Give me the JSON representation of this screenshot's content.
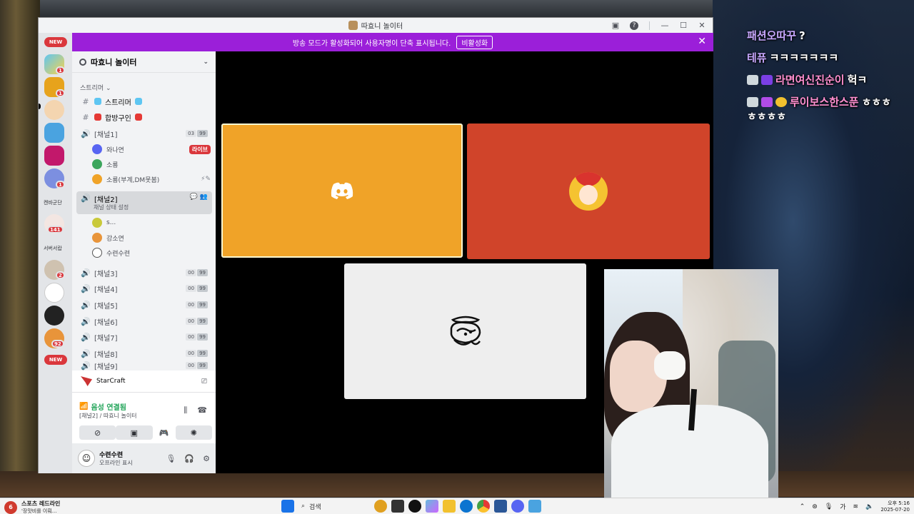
{
  "window": {
    "title": "따효니 놀이터"
  },
  "notice": {
    "text": "방송 모드가 활성화되어 사용자명이 단축 표시됩니다.",
    "button": "비활성화"
  },
  "servers": {
    "new_top": "NEW",
    "new_bottom": "NEW",
    "badges": [
      "1",
      "1",
      "1",
      "141",
      "2",
      "92"
    ],
    "labels": [
      "켄바군단",
      "서버서랍"
    ]
  },
  "guild": {
    "name": "따효니 놀이터"
  },
  "category": "스트리머",
  "text_channels": [
    {
      "label": "스트리머"
    },
    {
      "label": "합방구인"
    }
  ],
  "voice_channels": [
    {
      "label": "[채널1]",
      "c1": "03",
      "c2": "99"
    },
    {
      "label": "[채널2]",
      "sub": "채널 상태 설정"
    },
    {
      "label": "[채널3]",
      "c1": "00",
      "c2": "99"
    },
    {
      "label": "[채널4]",
      "c1": "00",
      "c2": "99"
    },
    {
      "label": "[채널5]",
      "c1": "00",
      "c2": "99"
    },
    {
      "label": "[채널6]",
      "c1": "00",
      "c2": "99"
    },
    {
      "label": "[채널7]",
      "c1": "00",
      "c2": "99"
    },
    {
      "label": "[채널8]",
      "c1": "00",
      "c2": "99"
    },
    {
      "label": "[채널9]",
      "c1": "00",
      "c2": "99"
    }
  ],
  "channel1_users": [
    {
      "name": "와나연",
      "badge": "라이브"
    },
    {
      "name": "소룡"
    },
    {
      "name": "소룡(부계,DM못봄)"
    }
  ],
  "channel2_users": [
    {
      "name": "s..."
    },
    {
      "name": "강소연"
    },
    {
      "name": "수련수련"
    }
  ],
  "activity": {
    "game": "StarCraft"
  },
  "voice": {
    "status": "음성 연결됨",
    "channel": "[채널2] / 따효니 놀이터"
  },
  "user": {
    "name": "수련수련",
    "status": "오프라인 표시"
  },
  "chat": [
    {
      "name": "패션오따꾸",
      "msg": "?"
    },
    {
      "name": "테퓨",
      "msg": "ㅋㅋㅋㅋㅋㅋㅋ"
    },
    {
      "name": "라면여신진순이",
      "msg": "헉ㅋ"
    },
    {
      "name": "루이보스한스푼",
      "msg": "ㅎㅎㅎ",
      "cont": "ㅎㅎㅎㅎ"
    }
  ],
  "taskbar": {
    "news_title": "스포츠 레드라인",
    "news_sub": "'장맛비를 이뤄...",
    "news_badge": "6",
    "search": "검색",
    "time": "오후 5:16",
    "date": "2025-07-20",
    "ime": "가"
  },
  "colors": {
    "notice": "#9b1fd9",
    "tile_orange": "#f0a328",
    "tile_red": "#d0442a",
    "voice_green": "#23a55a",
    "badge_red": "#da373c"
  }
}
